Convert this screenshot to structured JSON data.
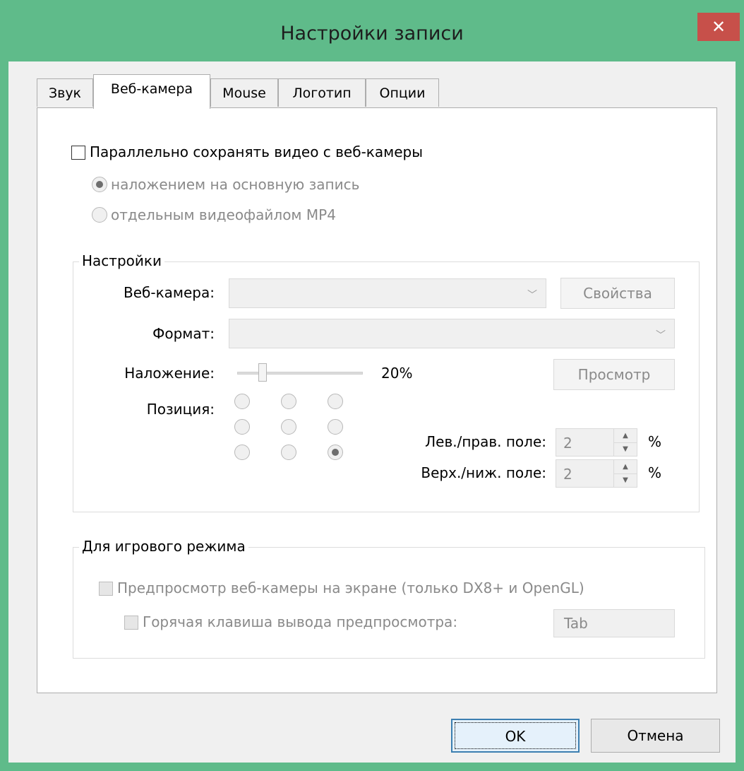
{
  "window": {
    "title": "Настройки записи",
    "close_glyph": "✕"
  },
  "tabs": [
    {
      "label": "Звук",
      "active": false
    },
    {
      "label": "Веб-камера",
      "active": true
    },
    {
      "label": "Mouse",
      "active": false
    },
    {
      "label": "Логотип",
      "active": false
    },
    {
      "label": "Опции",
      "active": false
    }
  ],
  "webcam": {
    "save_parallel_label": "Параллельно сохранять видео с веб-камеры",
    "save_parallel_checked": false,
    "mode_overlay_label": "наложением на основную запись",
    "mode_overlay_checked": true,
    "mode_file_label": "отдельным видеофайлом MP4",
    "mode_file_checked": false
  },
  "settings": {
    "title": "Настройки",
    "camera_label": "Веб-камера:",
    "camera_value": "",
    "properties_button": "Свойства",
    "format_label": "Формат:",
    "format_value": "",
    "overlay_label": "Наложение:",
    "overlay_value": "20%",
    "overlay_fraction": 0.2,
    "preview_button": "Просмотр",
    "position_label": "Позиция:",
    "position_selected": 8,
    "lr_margin_label": "Лев./прав. поле:",
    "lr_margin_value": "2",
    "tb_margin_label": "Верх./ниж. поле:",
    "tb_margin_value": "2",
    "unit": "%"
  },
  "game": {
    "title": "Для игрового режима",
    "preview_label": "Предпросмотр веб-камеры на экране (только DX8+ и OpenGL)",
    "preview_checked": false,
    "hotkey_label": "Горячая клавиша вывода предпросмотра:",
    "hotkey_checked": false,
    "hotkey_value": "Tab"
  },
  "buttons": {
    "ok": "OK",
    "cancel": "Отмена"
  },
  "icons": {
    "close": "close-icon",
    "combo_arrow": "chevron-down-icon",
    "spin_up": "arrow-up-icon",
    "spin_down": "arrow-down-icon"
  },
  "colors": {
    "frame": "#5fbb8a",
    "close": "#c7504a",
    "default_button_border": "#3c7fb1"
  }
}
